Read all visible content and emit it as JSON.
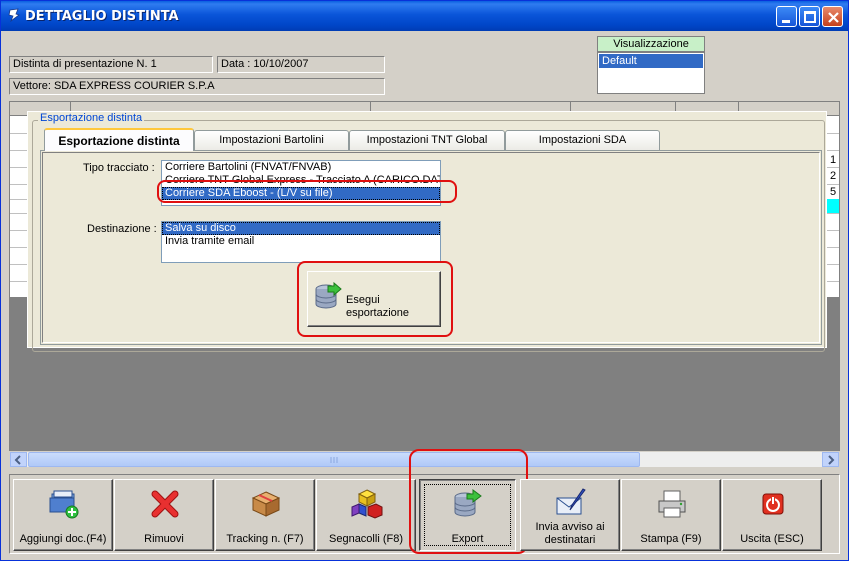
{
  "window": {
    "title": "DETTAGLIO DISTINTA"
  },
  "header": {
    "distinta": "Distinta di presentazione N. 1",
    "data": "Data : 10/10/2007",
    "vettore": "Vettore: SDA EXPRESS COURIER S.P.A"
  },
  "visualizzazione": {
    "label": "Visualizzazione",
    "items": [
      "Default"
    ]
  },
  "export_panel": {
    "group_title": "Esportazione distinta",
    "tabs": [
      {
        "label": "Esportazione distinta"
      },
      {
        "label": "Impostazioni Bartolini"
      },
      {
        "label": "Impostazioni TNT Global"
      },
      {
        "label": "Impostazioni SDA"
      }
    ],
    "tipo_label": "Tipo tracciato :",
    "tipo_items": [
      "Corriere Bartolini (FNVAT/FNVAB)",
      "Corriere TNT Global Express - Tracciato A (CARICO.DAT)",
      "Corriere SDA Eboost - (L/V su file)"
    ],
    "dest_label": "Destinazione :",
    "dest_items": [
      "Salva su disco",
      "Invia tramite email"
    ],
    "run_button": "Esegui esportazione"
  },
  "grid": {
    "right_marks": [
      "1",
      "2",
      "5"
    ]
  },
  "toolbar": {
    "buttons": [
      {
        "label": "Aggiungi doc.(F4)",
        "icon": "add-document-icon"
      },
      {
        "label": "Rimuovi",
        "icon": "remove-x-icon"
      },
      {
        "label": "Tracking n. (F7)",
        "icon": "package-icon"
      },
      {
        "label": "Segnacolli (F8)",
        "icon": "blocks-icon"
      },
      {
        "label": "Export",
        "icon": "database-export-icon"
      },
      {
        "label": "Invia avviso ai destinatari",
        "icon": "envelope-pen-icon"
      },
      {
        "label": "Stampa (F9)",
        "icon": "printer-icon"
      },
      {
        "label": "Uscita (ESC)",
        "icon": "exit-icon"
      }
    ]
  },
  "colors": {
    "title_bar": "#0a55d9",
    "selection": "#316ac5",
    "highlight_oval": "#e01010",
    "tab_accent": "#ffc83c"
  }
}
